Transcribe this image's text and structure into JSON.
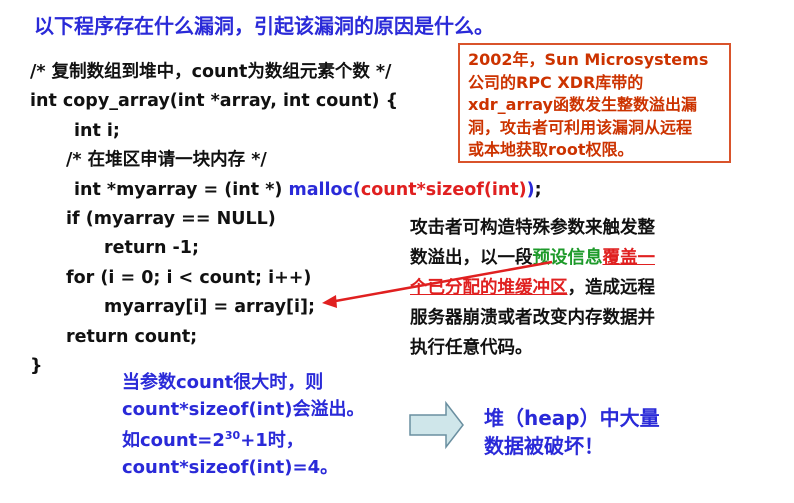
{
  "title": "以下程序存在什么漏洞，引起该漏洞的原因是什么。",
  "code": {
    "line1": "/* 复制数组到堆中，count为数组元素个数 */",
    "line2": "int copy_array(int *array, int count) {",
    "line3": "int i;",
    "line4": "/* 在堆区申请一块内存 */",
    "line5_pre": "int *myarray = (int *) ",
    "line5_malloc": "malloc(",
    "line5_arg": "count*sizeof(int)",
    "line5_post_paren": ")",
    "line5_end": ";",
    "line6": "if (myarray == NULL)",
    "line7": "return -1;",
    "line8": "for (i = 0; i < count; i++)",
    "line9": "myarray[i] = array[i];",
    "line10": "return count;",
    "line11": "}"
  },
  "callout": {
    "text": "2002年，Sun Microsystems公司的RPC XDR库带的xdr_array函数发生整数溢出漏洞，攻击者可利用该漏洞从远程或本地获取root权限。",
    "l1": "2002年，Sun Microsystems",
    "l2": "公司的RPC XDR库带的",
    "l3": "xdr_array函数发生整数溢出漏",
    "l4": "洞，攻击者可利用该漏洞从远程",
    "l5": "或本地获取root权限。"
  },
  "attack": {
    "l1": "攻击者可构造特殊参数来触发整",
    "l2_pre": "数溢出，以一段",
    "l2_green": "预设信息",
    "l2_red": "覆盖一",
    "l3_red": "个已分配的堆缓冲区",
    "l3_post": "，造成远程",
    "l4": "服务器崩溃或者改变内存数据并",
    "l5": "执行任意代码。"
  },
  "overflow_note": {
    "l1": "当参数count很大时，则",
    "l2": "count*sizeof(int)会溢出。",
    "l3_pre": "如count=2",
    "l3_sup": "30",
    "l3_post": "+1时，",
    "l4": "count*sizeof(int)=4。"
  },
  "heap_note": {
    "l1": "堆（heap）中大量",
    "l2": "数据被破坏！"
  },
  "colors": {
    "title_blue": "#2a2ad8",
    "highlight_red": "#e02020",
    "callout_border": "#d9532b",
    "highlight_green": "#1d9a2a",
    "arrow_fill": "#cfe6ea"
  },
  "icons": {
    "red_arrow": "pointer-arrow-icon",
    "block_arrow": "right-block-arrow-icon"
  }
}
